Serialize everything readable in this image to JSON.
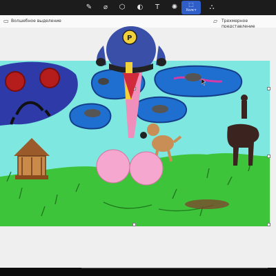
{
  "toolbar": {
    "tools": [
      {
        "name": "brush-tool",
        "glyph": "✎"
      },
      {
        "name": "marker-tool",
        "glyph": "⌀"
      },
      {
        "name": "shapes-tool",
        "glyph": "⬡"
      },
      {
        "name": "fill-tool",
        "glyph": "◐"
      },
      {
        "name": "text-tool",
        "glyph": "T"
      },
      {
        "name": "effects-tool",
        "glyph": "✺"
      },
      {
        "name": "view-tool",
        "glyph": "⛬"
      }
    ],
    "active_tool": {
      "glyph": "⬚",
      "label": "Холст"
    },
    "accent_color": "#2f5ec9"
  },
  "options": {
    "magic_select_label": "Волшебное выделение",
    "perspective_label": "Трехмерное представление"
  },
  "scene": {
    "sky_color": "#7ee7df",
    "grass_color": "#3ec43b"
  }
}
